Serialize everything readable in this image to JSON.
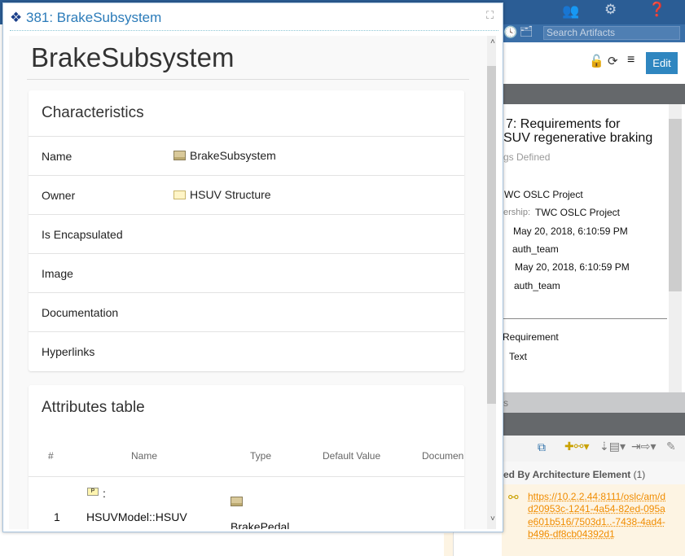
{
  "header": {
    "search_placeholder": "Search Artifacts",
    "edit_label": "Edit"
  },
  "artifact": {
    "title_line1": "7: Requirements for",
    "title_line2": "SUV regenerative braking",
    "status": "gs Defined",
    "project": "WC OSLC Project",
    "ownership_label": "ership:",
    "ownership": "TWC OSLC Project",
    "created_on": "May 20, 2018, 6:10:59 PM",
    "created_by": "auth_team",
    "modified_on": "May 20, 2018, 6:10:59 PM",
    "modified_by": "auth_team",
    "type": "Requirement",
    "format": "Text",
    "lower_band": "s"
  },
  "links": {
    "heading": "ed By Architecture Element",
    "count": "(1)",
    "url": "https://10.2.2.44:8111/oslc/am/dd20953c-1241-4a54-82ed-095ae601b516/7503d1..-7438-4ad4-b496-df8cb04392d1"
  },
  "dialog": {
    "title": "381: BrakeSubsystem",
    "heading": "BrakeSubsystem",
    "characteristics": {
      "title": "Characteristics",
      "rows": [
        {
          "key": "Name",
          "value": "BrakeSubsystem",
          "icon": "block-icon"
        },
        {
          "key": "Owner",
          "value": "HSUV Structure",
          "icon": "package-icon"
        },
        {
          "key": "Is Encapsulated",
          "value": ""
        },
        {
          "key": "Image",
          "value": ""
        },
        {
          "key": "Documentation",
          "value": ""
        },
        {
          "key": "Hyperlinks",
          "value": ""
        }
      ]
    },
    "attributes": {
      "title": "Attributes table",
      "columns": [
        "#",
        "Name",
        "Type",
        "Default Value",
        "Documen"
      ],
      "rows": [
        {
          "num": "1",
          "name_prefix": ":",
          "name": "HSUVModel::HSUV",
          "type": "BrakePedal"
        }
      ]
    }
  }
}
